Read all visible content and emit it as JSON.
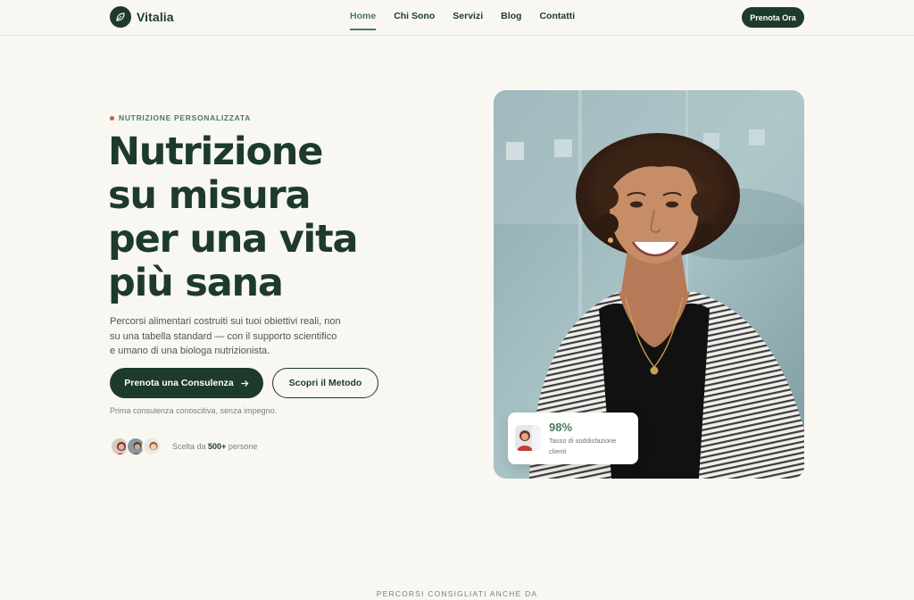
{
  "brand": {
    "name": "Vitalia"
  },
  "nav": {
    "items": [
      {
        "label": "Home",
        "active": true
      },
      {
        "label": "Chi Sono",
        "active": false
      },
      {
        "label": "Servizi",
        "active": false
      },
      {
        "label": "Blog",
        "active": false
      },
      {
        "label": "Contatti",
        "active": false
      }
    ],
    "cta_label": "Prenota Ora"
  },
  "hero": {
    "eyebrow": "NUTRIZIONE PERSONALIZZATA",
    "headline": [
      "Nutrizione",
      "su misura",
      "per una vita",
      "più sana"
    ],
    "description": "Percorsi alimentari costruiti sui tuoi obiettivi reali, non su una tabella standard — con il supporto scientifico e umano di una biologa nutrizionista.",
    "primary_cta": "Prenota una Consulenza",
    "primary_cta_icon": "arrow-right-icon",
    "secondary_cta": "Scopri il Metodo",
    "note": "Prima consulenza conoscitiva, senza impegno.",
    "social_proof": {
      "prefix": "Scelta da",
      "count": "500+",
      "suffix": "persone"
    }
  },
  "stat_card": {
    "value": "98%",
    "label": "Tasso di soddisfazione clienti"
  },
  "footer_label": "PERCORSI CONSIGLIATI ANCHE DA",
  "colors": {
    "background": "#f8f7f2",
    "primary": "#1d3a2c",
    "accent": "#4b7a5c",
    "eyebrow_dot": "#c0613a"
  }
}
